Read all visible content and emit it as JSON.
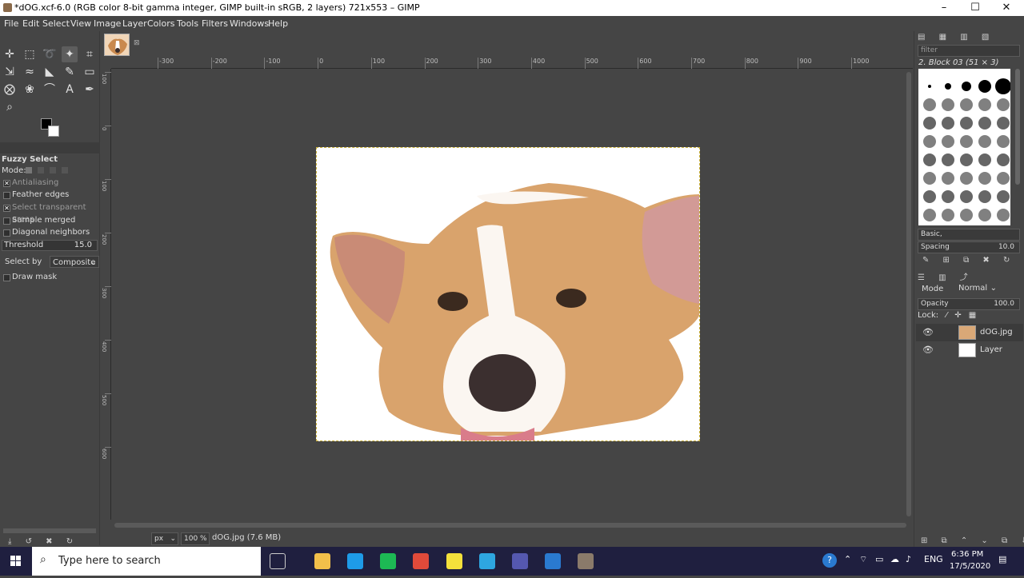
{
  "window": {
    "title": "*dOG.xcf-6.0 (RGB color 8-bit gamma integer, GIMP built-in sRGB, 2 layers) 721x553 – GIMP",
    "controls": {
      "minimize": "–",
      "maximize": "☐",
      "close": "✕"
    }
  },
  "menu": [
    "File",
    "Edit",
    "Select",
    "View",
    "Image",
    "Layer",
    "Colors",
    "Tools",
    "Filters",
    "Windows",
    "Help"
  ],
  "toolbox": {
    "tools": [
      {
        "name": "move-tool-icon",
        "glyph": "✛"
      },
      {
        "name": "rect-select-tool-icon",
        "glyph": "⬚"
      },
      {
        "name": "lasso-tool-icon",
        "glyph": "➰"
      },
      {
        "name": "fuzzy-select-tool-icon",
        "glyph": "✦",
        "active": true
      },
      {
        "name": "crop-tool-icon",
        "glyph": "⌗"
      },
      {
        "name": "transform-tool-icon",
        "glyph": "⇲"
      },
      {
        "name": "warp-tool-icon",
        "glyph": "≈"
      },
      {
        "name": "bucket-fill-tool-icon",
        "glyph": "◣"
      },
      {
        "name": "paintbrush-tool-icon",
        "glyph": "✎"
      },
      {
        "name": "eraser-tool-icon",
        "glyph": "▭"
      },
      {
        "name": "clone-tool-icon",
        "glyph": "⨂"
      },
      {
        "name": "smudge-tool-icon",
        "glyph": "❀"
      },
      {
        "name": "paths-tool-icon",
        "glyph": "⌒"
      },
      {
        "name": "text-tool-icon",
        "glyph": "A"
      },
      {
        "name": "color-picker-tool-icon",
        "glyph": "✒"
      },
      {
        "name": "zoom-tool-icon",
        "glyph": "⌕"
      }
    ],
    "options": {
      "title": "Fuzzy Select",
      "mode_label": "Mode:",
      "antialiasing": {
        "label": "Antialiasing",
        "checked": true
      },
      "feather_edges": {
        "label": "Feather edges",
        "checked": false
      },
      "select_transparent": {
        "label": "Select transparent areas",
        "checked": true
      },
      "sample_merged": {
        "label": "Sample merged",
        "checked": false
      },
      "diagonal_neighbors": {
        "label": "Diagonal neighbors",
        "checked": false
      },
      "threshold": {
        "label": "Threshold",
        "value": "15.0"
      },
      "select_by": {
        "label": "Select by",
        "value": "Composite"
      },
      "draw_mask": {
        "label": "Draw mask",
        "checked": false
      }
    }
  },
  "ruler": {
    "h_labels": [
      "-300",
      "-200",
      "-100",
      "0",
      "100",
      "200",
      "300",
      "400",
      "500",
      "600",
      "700",
      "800",
      "900",
      "1000"
    ],
    "v_labels": [
      "100",
      "0",
      "100",
      "200",
      "300",
      "400",
      "500",
      "600"
    ]
  },
  "status": {
    "unit": "px",
    "zoom": "100 %",
    "info": "dOG.jpg (7.6 MB)"
  },
  "brushes": {
    "filter_placeholder": "filter",
    "selected": "2. Block 03 (51 × 3)",
    "tag": "Basic,",
    "spacing_label": "Spacing",
    "spacing_value": "10.0"
  },
  "layers": {
    "mode_label": "Mode",
    "mode_value": "Normal",
    "opacity_label": "Opacity",
    "opacity_value": "100.0",
    "lock_label": "Lock:",
    "items": [
      {
        "name": "dOG.jpg",
        "thumb_color": "#d9a877",
        "selected": true
      },
      {
        "name": "Layer",
        "thumb_color": "#ffffff",
        "selected": false
      }
    ]
  },
  "taskbar": {
    "search_placeholder": "Type here to search",
    "time": "6:36 PM",
    "date": "17/5/2020",
    "lang": "ENG",
    "apps": [
      {
        "name": "task-view-icon",
        "color": "#1f1f3f"
      },
      {
        "name": "file-explorer-icon",
        "color": "#f2c04a"
      },
      {
        "name": "skype-icon",
        "color": "#1e9be8"
      },
      {
        "name": "spotify-icon",
        "color": "#1db954"
      },
      {
        "name": "chrome-icon",
        "color": "#e04a3a"
      },
      {
        "name": "sticky-notes-icon",
        "color": "#f4e13b"
      },
      {
        "name": "telegram-icon",
        "color": "#2ea6e0"
      },
      {
        "name": "teams-icon",
        "color": "#5558af"
      },
      {
        "name": "jupyter-icon",
        "color": "#2a7ad0"
      },
      {
        "name": "gimp-icon",
        "color": "#8a7a6a"
      }
    ]
  }
}
